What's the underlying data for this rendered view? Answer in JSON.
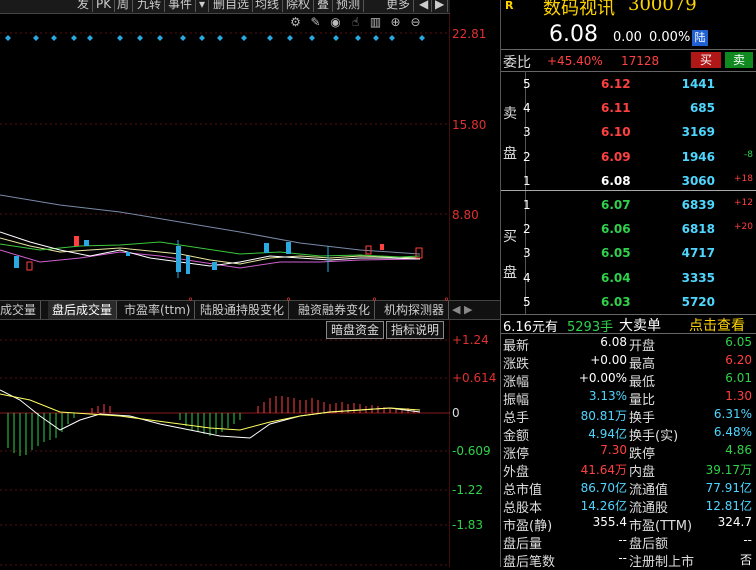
{
  "toolbar": {
    "items": [
      "发",
      "PK",
      "周",
      "九转",
      "事件",
      "▾",
      "删自选",
      "均线",
      "除权",
      "叠",
      "预测",
      "更多",
      "◀",
      "▶"
    ]
  },
  "chart_tools": {
    "icons": [
      "gear-icon",
      "pen-icon",
      "eye-icon",
      "hand-icon",
      "trash-icon",
      "plus-circle-icon",
      "minus-circle-icon"
    ]
  },
  "kline_axis": {
    "labels": [
      "22.81",
      "15.80",
      "8.80"
    ]
  },
  "tabs": [
    "成交量",
    "盘后成交量",
    "市盈率(ttm)",
    "陆股通持股变化",
    "融资融券变化",
    "机构探测器"
  ],
  "tab_marks": [
    "°",
    "°",
    "°",
    "°"
  ],
  "indicator": {
    "buttons": [
      "暗盘资金",
      "指标说明"
    ],
    "axis": [
      "+1.24",
      "+0.614",
      "0",
      "-0.609",
      "-1.22",
      "-1.83"
    ]
  },
  "quote": {
    "badge": "R",
    "name": "数码视讯",
    "code": "300079",
    "price": "6.08",
    "change": "0.00",
    "change_pct": "0.00%",
    "market": "陆",
    "ratio_label": "委比",
    "ratio_value": "+45.40%",
    "ratio_diff": "17128",
    "buy_btn": "买",
    "sell_btn": "卖"
  },
  "sell_orders": {
    "label": [
      "卖",
      "盘"
    ],
    "rows": [
      {
        "n": "5",
        "price": "6.12",
        "vol": "1441",
        "delta": ""
      },
      {
        "n": "4",
        "price": "6.11",
        "vol": "685",
        "delta": ""
      },
      {
        "n": "3",
        "price": "6.10",
        "vol": "3169",
        "delta": ""
      },
      {
        "n": "2",
        "price": "6.09",
        "vol": "1946",
        "delta": "-8"
      },
      {
        "n": "1",
        "price": "6.08",
        "vol": "3060",
        "delta": "+18"
      }
    ]
  },
  "buy_orders": {
    "label": [
      "买",
      "盘"
    ],
    "rows": [
      {
        "n": "1",
        "price": "6.07",
        "vol": "6839",
        "delta": "+12"
      },
      {
        "n": "2",
        "price": "6.06",
        "vol": "6818",
        "delta": "+20"
      },
      {
        "n": "3",
        "price": "6.05",
        "vol": "4717",
        "delta": ""
      },
      {
        "n": "4",
        "price": "6.04",
        "vol": "3335",
        "delta": ""
      },
      {
        "n": "5",
        "price": "6.03",
        "vol": "5720",
        "delta": ""
      }
    ]
  },
  "big_order": {
    "price": "6.16元有",
    "volume": "5293手",
    "text": "大卖单",
    "link": "点击查看"
  },
  "stats": [
    {
      "l1": "最新",
      "v1": "6.08",
      "c1": "white",
      "l2": "开盘",
      "v2": "6.05",
      "c2": "green"
    },
    {
      "l1": "涨跌",
      "v1": "+0.00",
      "c1": "white",
      "l2": "最高",
      "v2": "6.20",
      "c2": "red"
    },
    {
      "l1": "涨幅",
      "v1": "+0.00%",
      "c1": "white",
      "l2": "最低",
      "v2": "6.01",
      "c2": "green"
    },
    {
      "l1": "振幅",
      "v1": "3.13%",
      "c1": "cyan",
      "l2": "量比",
      "v2": "1.30",
      "c2": "red"
    },
    {
      "l1": "总手",
      "v1": "80.81万",
      "c1": "cyan",
      "l2": "换手",
      "v2": "6.31%",
      "c2": "cyan"
    },
    {
      "l1": "金额",
      "v1": "4.94亿",
      "c1": "cyan",
      "l2": "换手(实)",
      "v2": "6.48%",
      "c2": "cyan"
    },
    {
      "l1": "涨停",
      "v1": "7.30",
      "c1": "red",
      "l2": "跌停",
      "v2": "4.86",
      "c2": "green"
    },
    {
      "l1": "外盘",
      "v1": "41.64万",
      "c1": "red",
      "l2": "内盘",
      "v2": "39.17万",
      "c2": "green"
    },
    {
      "l1": "总市值",
      "v1": "86.70亿",
      "c1": "cyan",
      "l2": "流通值",
      "v2": "77.91亿",
      "c2": "cyan"
    },
    {
      "l1": "总股本",
      "v1": "14.26亿",
      "c1": "cyan",
      "l2": "流通股",
      "v2": "12.81亿",
      "c2": "cyan"
    },
    {
      "l1": "市盈(静)",
      "v1": "355.4",
      "c1": "white",
      "l2": "市盈(TTM)",
      "v2": "324.7",
      "c2": "white"
    },
    {
      "l1": "盘后量",
      "v1": "--",
      "c1": "white",
      "l2": "盘后额",
      "v2": "--",
      "c2": "white"
    },
    {
      "l1": "盘后笔数",
      "v1": "--",
      "c1": "white",
      "l2": "注册制上市",
      "v2": "否",
      "c2": "white"
    }
  ],
  "colors": {
    "up": "#ff4040",
    "down": "#2fd24a",
    "accent": "#ffd400",
    "cyan": "#4fd6ff"
  }
}
